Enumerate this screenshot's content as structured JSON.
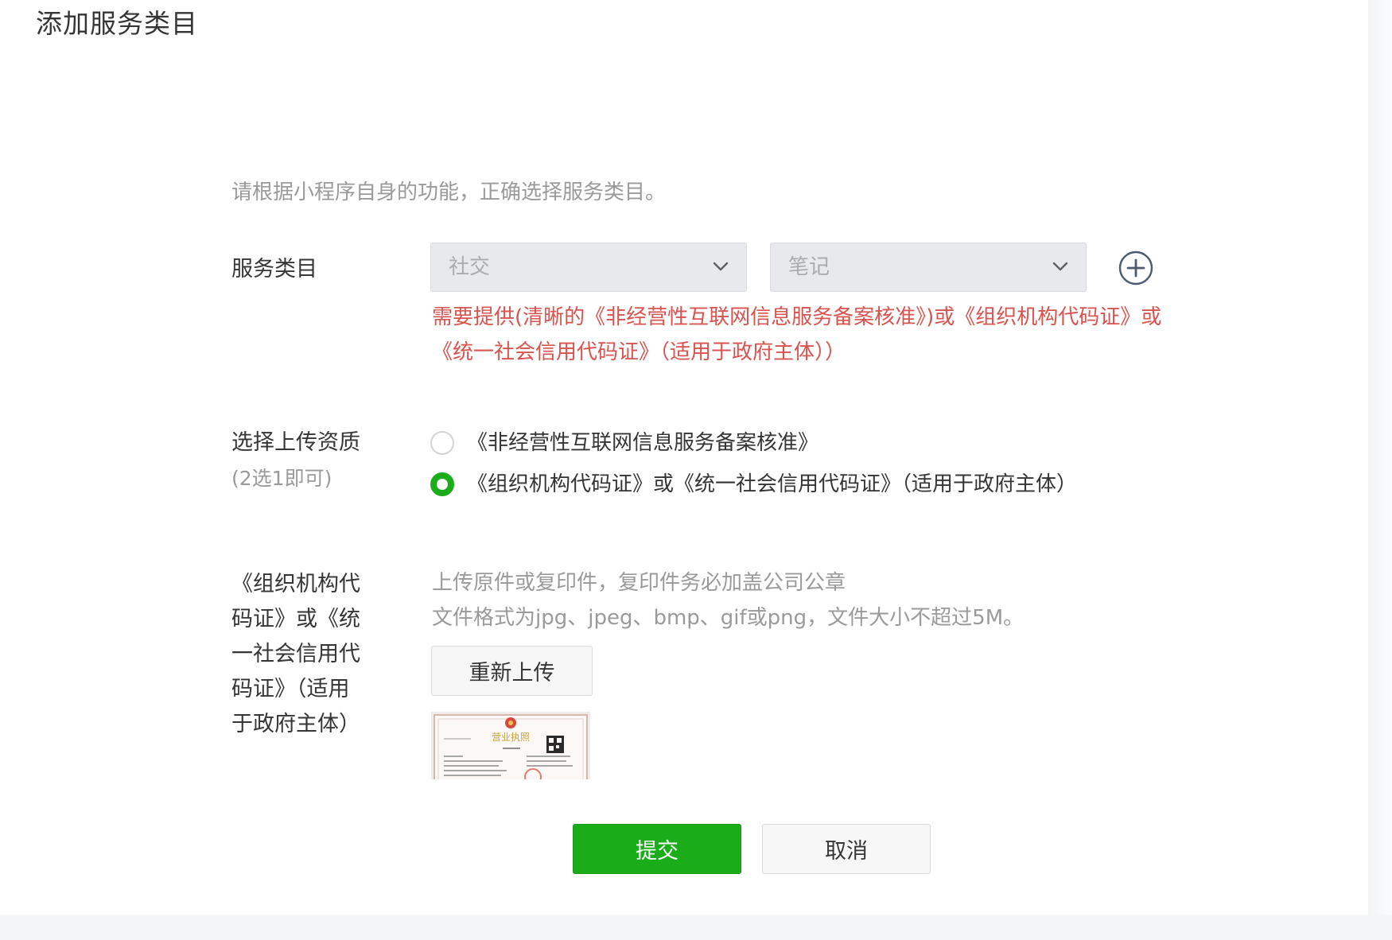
{
  "page": {
    "title": "添加服务类目"
  },
  "form": {
    "hint": "请根据小程序自身的功能，正确选择服务类目。",
    "category": {
      "label": "服务类目",
      "primary_value": "社交",
      "secondary_value": "笔记",
      "add_icon": "plus-circle-icon",
      "warning_line1": "需要提供(清晰的《非经营性互联网信息服务备案核准》)或《组织机构代码证》或",
      "warning_line2": "《统一社会信用代码证》（适用于政府主体））"
    },
    "qualification": {
      "label": "选择上传资质",
      "sub_label": "(2选1即可)",
      "options": [
        {
          "label": "《非经营性互联网信息服务备案核准》",
          "checked": false
        },
        {
          "label": "《组织机构代码证》或《统一社会信用代码证》（适用于政府主体）",
          "checked": true
        }
      ]
    },
    "upload": {
      "label_lines": [
        "《组织机构代",
        "码证》或《统",
        "一社会信用代",
        "码证》（适用",
        "于政府主体）"
      ],
      "hint_line1": "上传原件或复印件，复印件务必加盖公司公章",
      "hint_line2": "文件格式为jpg、jpeg、bmp、gif或png，文件大小不超过5M。",
      "reupload_label": "重新上传",
      "thumbnail_stamp_text": "营业执照"
    }
  },
  "actions": {
    "submit_label": "提交",
    "cancel_label": "取消"
  },
  "colors": {
    "accent_green": "#1aad19",
    "warning_red": "#d9534f",
    "hint_gray": "#9a9a9a",
    "text_dark": "#353535"
  }
}
